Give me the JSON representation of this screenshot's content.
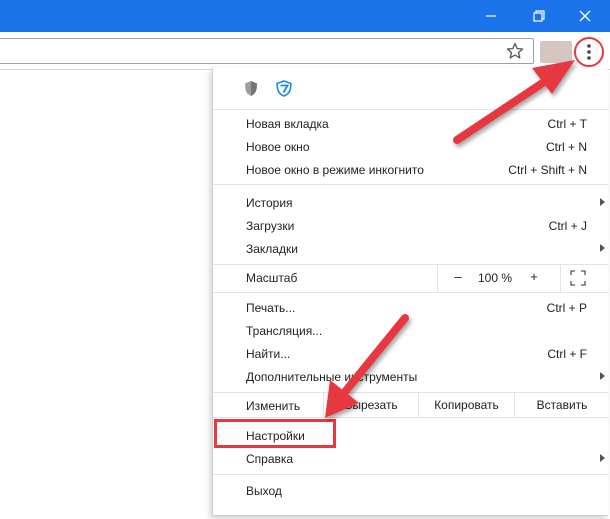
{
  "window": {
    "controls": [
      "minimize",
      "maximize",
      "close"
    ]
  },
  "toolbar": {
    "bookmark_icon": "star-icon",
    "menu_icon": "three-dots-vertical-icon"
  },
  "menu": {
    "extensions": [
      "shield-extension-icon",
      "vpn-extension-icon"
    ],
    "group1": [
      {
        "label": "Новая вкладка",
        "shortcut": "Ctrl + T"
      },
      {
        "label": "Новое окно",
        "shortcut": "Ctrl + N"
      },
      {
        "label": "Новое окно в режиме инкогнито",
        "shortcut": "Ctrl + Shift + N"
      }
    ],
    "group2": [
      {
        "label": "История",
        "shortcut": ""
      },
      {
        "label": "Загрузки",
        "shortcut": "Ctrl + J"
      },
      {
        "label": "Закладки",
        "shortcut": ""
      }
    ],
    "zoom": {
      "label": "Масштаб",
      "minus": "–",
      "value": "100 %",
      "plus": "+"
    },
    "group3": [
      {
        "label": "Печать...",
        "shortcut": "Ctrl + P"
      },
      {
        "label": "Трансляция...",
        "shortcut": ""
      },
      {
        "label": "Найти...",
        "shortcut": "Ctrl + F"
      },
      {
        "label": "Дополнительные инструменты",
        "shortcut": ""
      }
    ],
    "edit": {
      "label": "Изменить",
      "cut": "Вырезать",
      "copy": "Копировать",
      "paste": "Вставить"
    },
    "group4": [
      {
        "label": "Настройки",
        "shortcut": ""
      },
      {
        "label": "Справка",
        "shortcut": ""
      }
    ],
    "exit": {
      "label": "Выход"
    }
  },
  "colors": {
    "titlebar": "#1a73e8",
    "annotation": "#e6393f"
  }
}
